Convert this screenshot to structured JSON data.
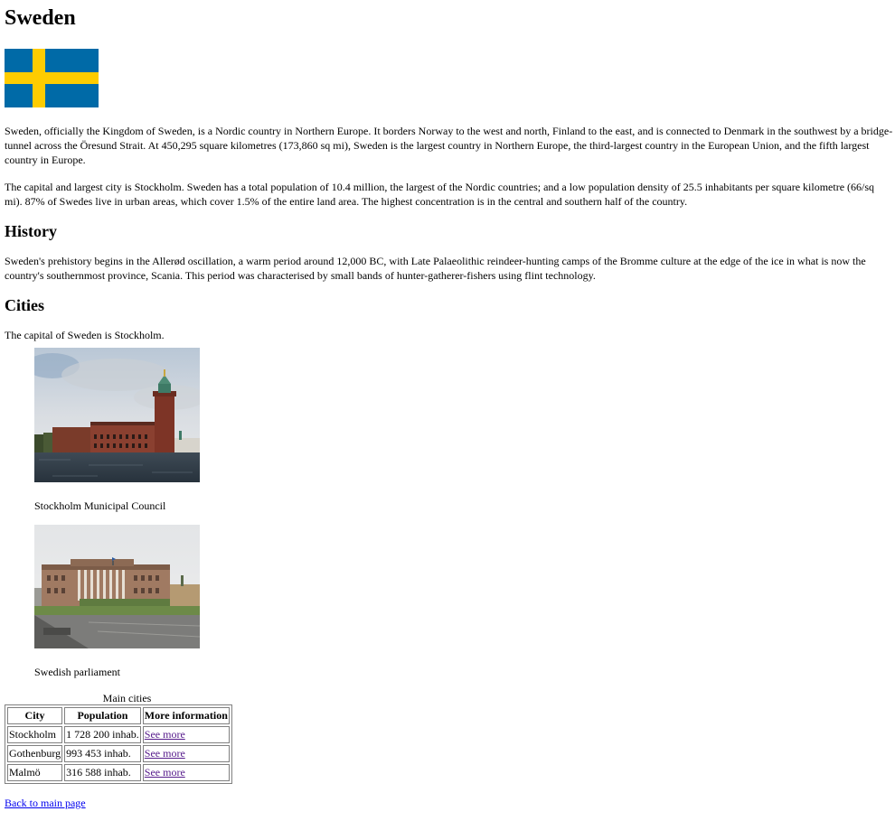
{
  "title": "Sweden",
  "flag": {
    "name": "Flag of Sweden",
    "colors": {
      "blue": "#006AA7",
      "yellow": "#FECC00"
    }
  },
  "paragraphs": {
    "intro": "Sweden, officially the Kingdom of Sweden, is a Nordic country in Northern Europe. It borders Norway to the west and north, Finland to the east, and is connected to Denmark in the southwest by a bridge-tunnel across the Öresund Strait. At 450,295 square kilometres (173,860 sq mi), Sweden is the largest country in Northern Europe, the third-largest country in the European Union, and the fifth largest country in Europe.",
    "population": "The capital and largest city is Stockholm. Sweden has a total population of 10.4 million, the largest of the Nordic countries; and a low population density of 25.5 inhabitants per square kilometre (66/sq mi). 87% of Swedes live in urban areas, which cover 1.5% of the entire land area. The highest concentration is in the central and southern half of the country."
  },
  "history": {
    "heading": "History",
    "text": "Sweden's prehistory begins in the Allerød oscillation, a warm period around 12,000 BC, with Late Palaeolithic reindeer-hunting camps of the Bromme culture at the edge of the ice in what is now the country's southernmost province, Scania. This period was characterised by small bands of hunter-gatherer-fishers using flint technology."
  },
  "cities": {
    "heading": "Cities",
    "text": "The capital of Sweden is Stockholm.",
    "figures": [
      {
        "caption": "Stockholm Municipal Council"
      },
      {
        "caption": "Swedish parliament"
      }
    ],
    "table": {
      "caption": "Main cities",
      "headers": [
        "City",
        "Population",
        "More information"
      ],
      "rows": [
        {
          "city": "Stockholm",
          "population": "1 728 200 inhab.",
          "link": "See more"
        },
        {
          "city": "Gothenburg",
          "population": "993 453 inhab.",
          "link": "See more"
        },
        {
          "city": "Malmö",
          "population": "316 588 inhab.",
          "link": "See more"
        }
      ]
    }
  },
  "back_link": "Back to main page"
}
